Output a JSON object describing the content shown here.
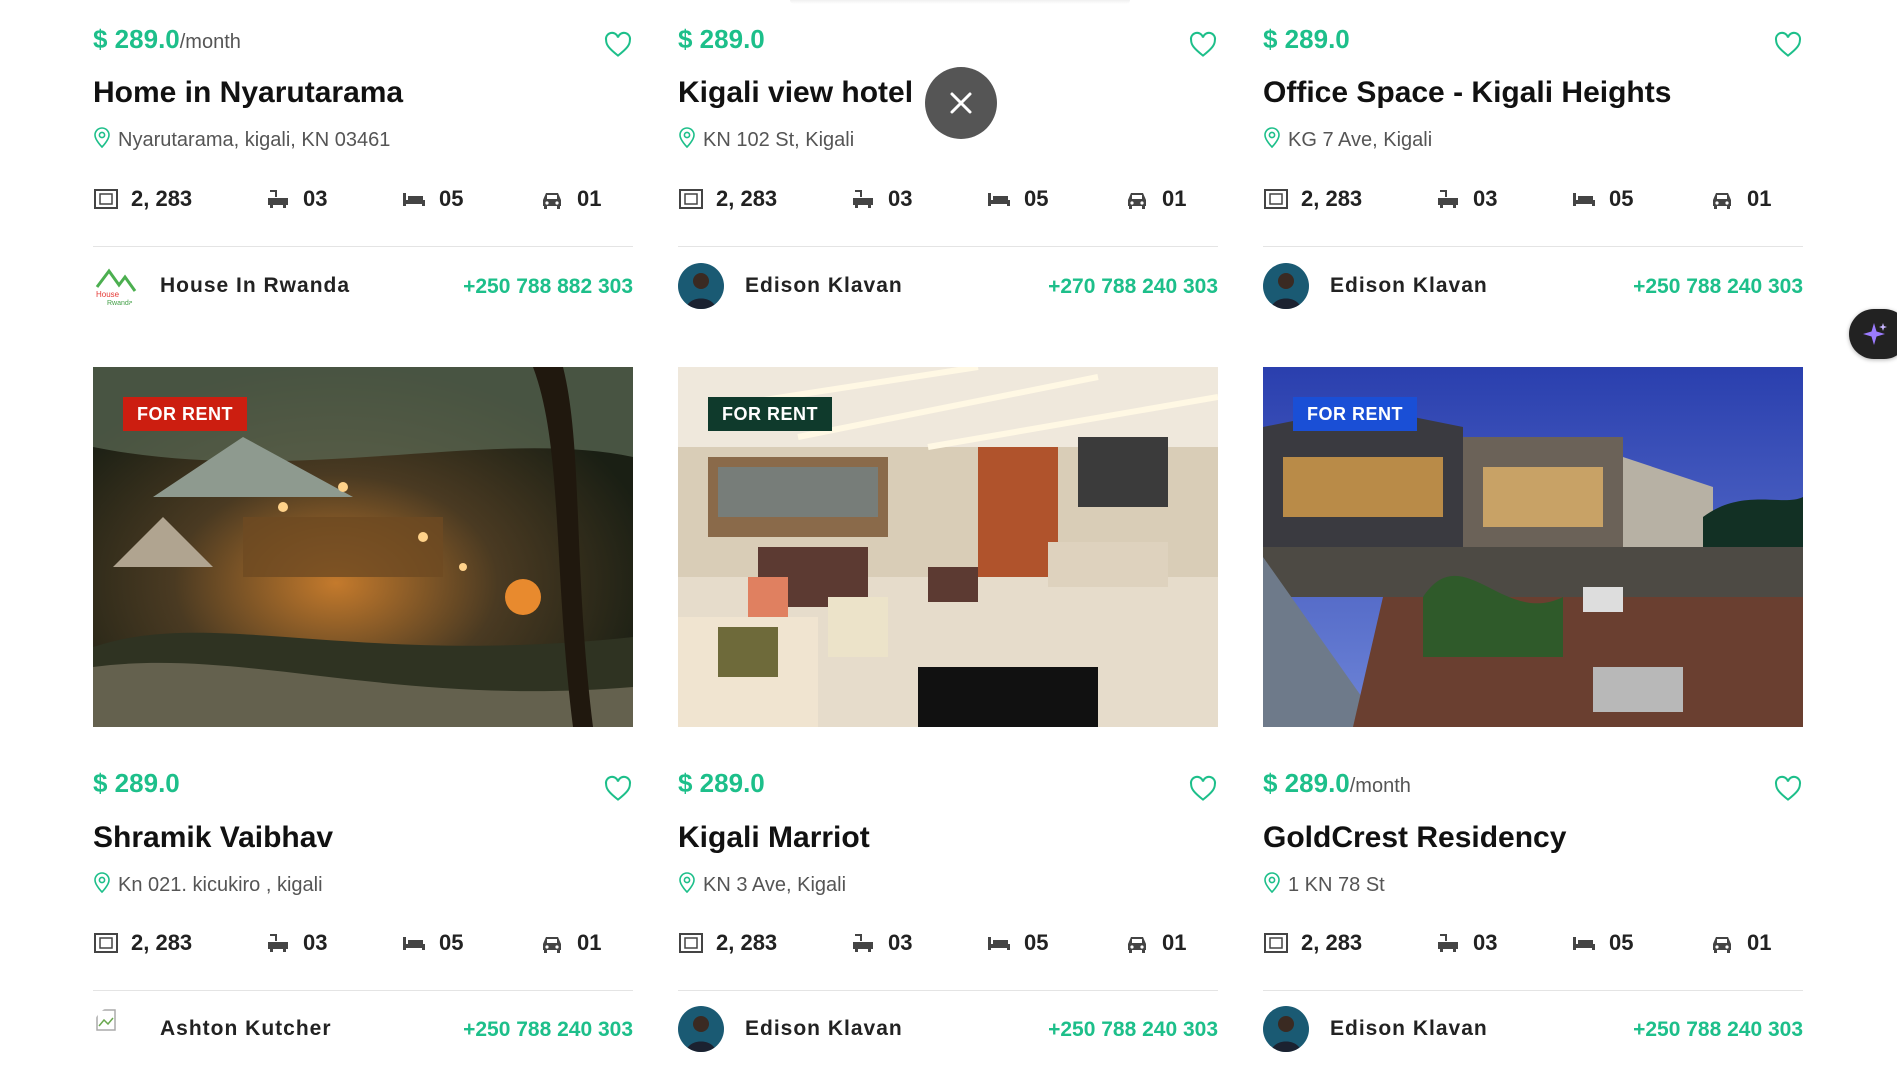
{
  "listings": [
    {
      "price": "$ 289.0",
      "unit": "/month",
      "title": "Home in Nyarutarama",
      "address": "Nyarutarama, kigali, KN 03461",
      "area": "2, 283",
      "baths": "03",
      "beds": "05",
      "garage": "01",
      "agent": "House In Rwanda",
      "phone": "+250 788 882 303",
      "avatar": "house-in-rwanda-logo"
    },
    {
      "price": "$ 289.0",
      "unit": "",
      "title": "Kigali view hotel",
      "address": "KN 102 St, Kigali",
      "area": "2, 283",
      "baths": "03",
      "beds": "05",
      "garage": "01",
      "agent": "Edison Klavan",
      "phone": "+270 788 240 303",
      "avatar": "person-photo"
    },
    {
      "price": "$ 289.0",
      "unit": "",
      "title": "Office Space - Kigali Heights",
      "address": "KG 7 Ave, Kigali",
      "area": "2, 283",
      "baths": "03",
      "beds": "05",
      "garage": "01",
      "agent": "Edison Klavan",
      "phone": "+250 788 240 303",
      "avatar": "person-photo"
    },
    {
      "badge": "FOR RENT",
      "badge_color": "#cc1e10",
      "price": "$ 289.0",
      "unit": "",
      "title": "Shramik Vaibhav",
      "address": "Kn 021. kicukiro , kigali",
      "area": "2, 283",
      "baths": "03",
      "beds": "05",
      "garage": "01",
      "agent": "Ashton Kutcher",
      "phone": "+250 788 240 303",
      "avatar": "broken-image"
    },
    {
      "badge": "FOR RENT",
      "badge_color": "#0f3a2c",
      "price": "$ 289.0",
      "unit": "",
      "title": "Kigali Marriot",
      "address": "KN 3 Ave, Kigali",
      "area": "2, 283",
      "baths": "03",
      "beds": "05",
      "garage": "01",
      "agent": "Edison Klavan",
      "phone": "+250 788 240 303",
      "avatar": "person-photo"
    },
    {
      "badge": "FOR RENT",
      "badge_color": "#1a4fd6",
      "price": "$ 289.0",
      "unit": "/month",
      "title": "GoldCrest Residency",
      "address": "1 KN 78 St",
      "area": "2, 283",
      "baths": "03",
      "beds": "05",
      "garage": "01",
      "agent": "Edison Klavan",
      "phone": "+250 788 240 303",
      "avatar": "person-photo"
    }
  ],
  "icons": {
    "favorite": "heart-outline-icon",
    "location": "map-pin-icon",
    "area": "area-icon",
    "bath": "bathtub-icon",
    "bed": "bed-icon",
    "garage": "car-icon",
    "close": "close-icon",
    "assistant": "sparkle-icon"
  },
  "colors": {
    "accent": "#1dbf8a",
    "text": "#111111",
    "muted": "#555555"
  }
}
